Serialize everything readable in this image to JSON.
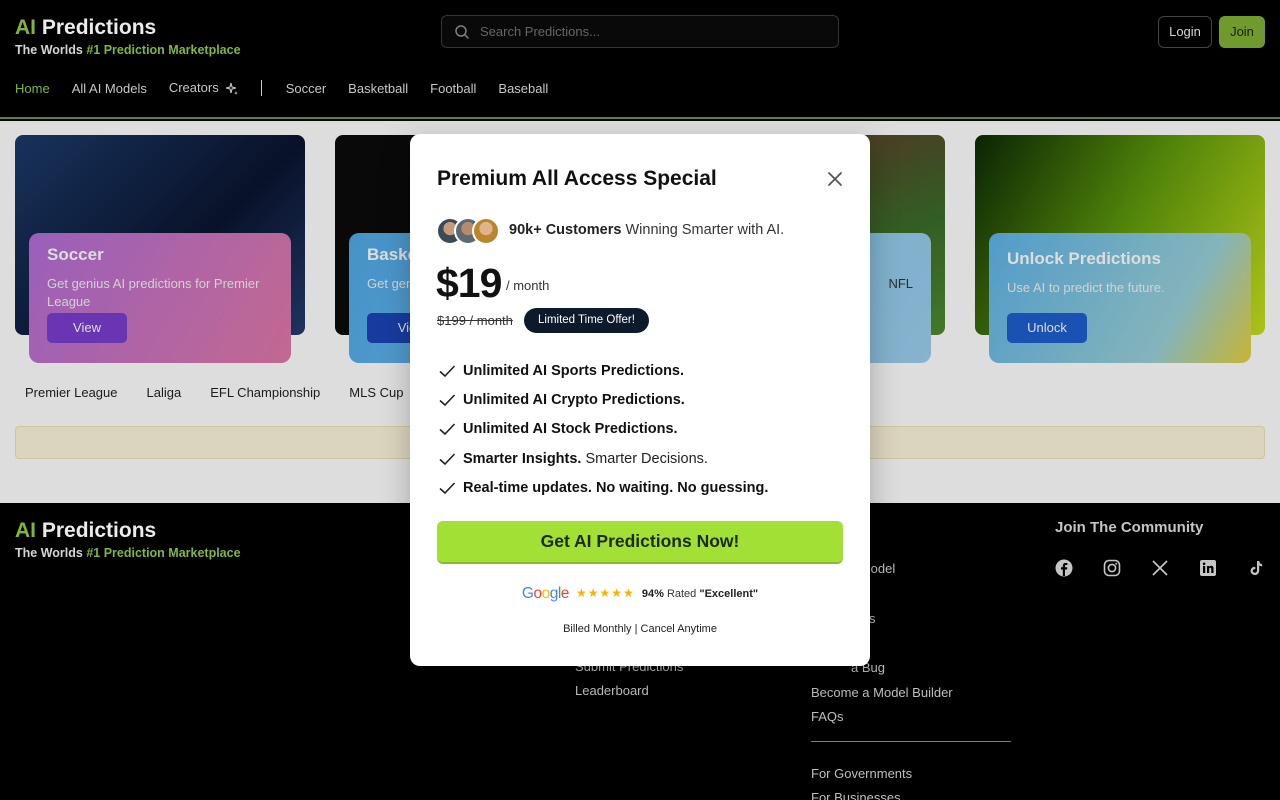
{
  "header": {
    "brand_ai": "AI",
    "brand_rest": "Predictions",
    "tagline_prefix": "The Worlds ",
    "tagline_highlight": "#1 Prediction Marketplace",
    "search_placeholder": "Search Predictions...",
    "login_label": "Login",
    "join_label": "Join"
  },
  "nav": {
    "items": [
      "Home",
      "All AI Models",
      "Creators"
    ],
    "sports": [
      "Soccer",
      "Basketball",
      "Football",
      "Baseball"
    ]
  },
  "cards": [
    {
      "title": "Soccer",
      "desc": "Get genius AI predictions for Premier League",
      "button": "View"
    },
    {
      "title": "Baske",
      "desc": "Get gen",
      "button": "Vie"
    },
    {
      "title": "",
      "desc": "NFL",
      "button": ""
    },
    {
      "title": "Unlock Predictions",
      "desc": "Use AI to predict the future.",
      "button": "Unlock"
    }
  ],
  "leagues": [
    "Premier League",
    "Laliga",
    "EFL Championship",
    "MLS Cup"
  ],
  "footer": {
    "brand_ai": "AI",
    "brand_rest": "Predictions",
    "tagline_prefix": "The Worlds ",
    "tagline_highlight": "#1 Prediction Marketplace",
    "resources_title": "es",
    "resources_links": [
      "d Model",
      "s",
      "a Bug",
      "Become a Model Builder",
      "FAQs"
    ],
    "gov_links": [
      "For Governments",
      "For Businesses"
    ],
    "col2_links": [
      "Submit Predictions",
      "Leaderboard"
    ],
    "community_title": "Join The Community"
  },
  "modal": {
    "title": "Premium All Access Special",
    "customers_bold": "90k+ Customers",
    "customers_rest": " Winning Smarter with AI.",
    "price": "$19",
    "per": "/ month",
    "old_price": "$199 / month",
    "badge": "Limited Time Offer!",
    "features": [
      {
        "bold": "Unlimited AI Sports Predictions.",
        "rest": ""
      },
      {
        "bold": "Unlimited AI Crypto Predictions.",
        "rest": ""
      },
      {
        "bold": "Unlimited AI Stock Predictions.",
        "rest": ""
      },
      {
        "bold": "Smarter Insights.",
        "rest": "Smarter Decisions."
      },
      {
        "bold": "Real-time updates. No waiting. No guessing.",
        "rest": ""
      }
    ],
    "cta": "Get AI Predictions Now!",
    "rating_percent": "94%",
    "rating_text": "Rated",
    "rating_quote": "\"Excellent\"",
    "billing": "Billed Monthly | Cancel Anytime"
  },
  "colors": {
    "accent_green": "#8cc63f",
    "cta_green": "#a2e035",
    "badge_navy": "#0d1a2b"
  },
  "icons": {
    "search": "search-icon",
    "close": "close-icon",
    "check": "check-icon",
    "sparkle": "sparkle-icon",
    "socials": [
      "facebook-icon",
      "instagram-icon",
      "x-icon",
      "linkedin-icon",
      "tiktok-icon"
    ]
  }
}
